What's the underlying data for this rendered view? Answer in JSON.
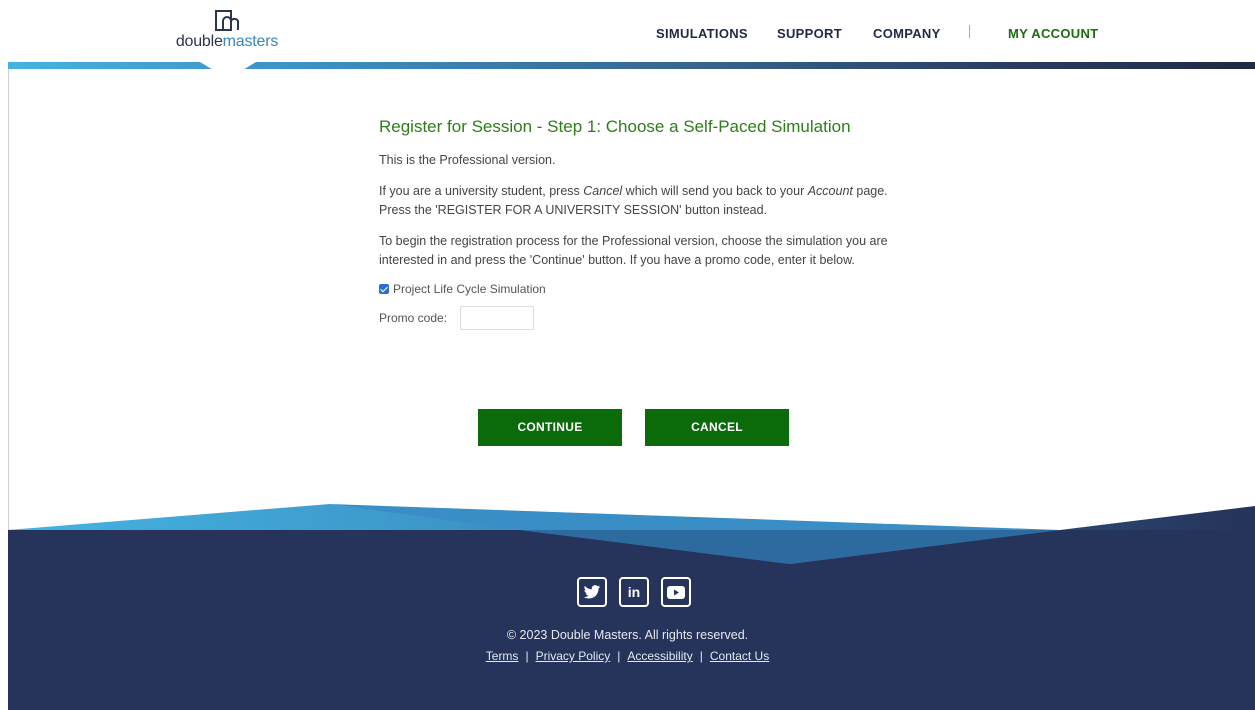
{
  "header": {
    "logo_text_a": "double",
    "logo_text_b": "masters",
    "nav": {
      "simulations": "SIMULATIONS",
      "support": "SUPPORT",
      "company": "COMPANY",
      "my_account": "MY ACCOUNT"
    }
  },
  "main": {
    "title": "Register for Session - Step 1: Choose a Self-Paced Simulation",
    "para1": "This is the Professional version.",
    "para2_a": "If you are a university student, press ",
    "para2_cancel": "Cancel",
    "para2_b": " which will send you back to your ",
    "para2_account": "Account",
    "para2_c": " page. Press the 'REGISTER FOR A UNIVERSITY SESSION' button instead.",
    "para3": "To begin the registration process for the Professional version, choose the simulation you are interested in and press the 'Continue' button. If you have a promo code, enter it below.",
    "simulation_option": {
      "label": "Project Life Cycle Simulation",
      "checked": true
    },
    "promo": {
      "label": "Promo code:",
      "value": ""
    },
    "buttons": {
      "continue": "CONTINUE",
      "cancel": "CANCEL"
    }
  },
  "footer": {
    "social_icons": [
      "twitter-icon",
      "linkedin-icon",
      "youtube-icon"
    ],
    "copyright": "© 2023 Double Masters. All rights reserved.",
    "links": {
      "terms": "Terms",
      "privacy": "Privacy Policy",
      "accessibility": "Accessibility",
      "contact": "Contact Us"
    }
  },
  "colors": {
    "accent_green": "#2e7d1a",
    "button_green": "#0b6b0b",
    "navy": "#26335a",
    "sky": "#45b3e0"
  }
}
